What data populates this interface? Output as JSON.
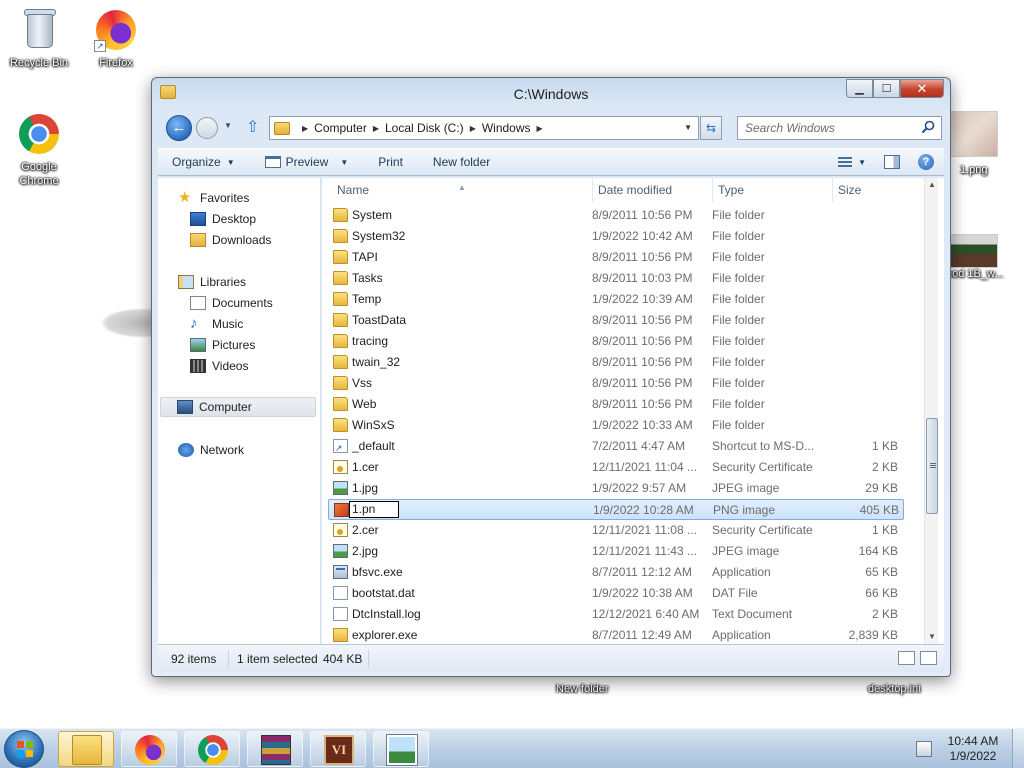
{
  "desktop": {
    "icons": [
      {
        "label": "Recycle Bin",
        "icon": "recycle-bin-icon"
      },
      {
        "label": "Firefox",
        "icon": "firefox-icon"
      },
      {
        "label": "Google Chrome",
        "icon": "chrome-icon"
      }
    ],
    "partial_labels": {
      "right_png": "1.png",
      "right_video": "nod 1B_w...",
      "new_folder": "New folder",
      "desktop_ini": "desktop.ini"
    }
  },
  "window": {
    "title": "C:\\Windows",
    "address": {
      "crumbs": [
        "Computer",
        "Local Disk (C:)",
        "Windows"
      ]
    },
    "search_placeholder": "Search Windows",
    "toolbar": {
      "organize": "Organize",
      "preview": "Preview",
      "print": "Print",
      "new_folder": "New folder"
    },
    "nav_pane": {
      "favorites": "Favorites",
      "desktop": "Desktop",
      "downloads": "Downloads",
      "libraries": "Libraries",
      "documents": "Documents",
      "music": "Music",
      "pictures": "Pictures",
      "videos": "Videos",
      "computer": "Computer",
      "network": "Network"
    },
    "columns": {
      "name": "Name",
      "date": "Date modified",
      "type": "Type",
      "size": "Size"
    },
    "files": [
      {
        "name": "System",
        "date": "8/9/2011 10:56 PM",
        "type": "File folder",
        "size": "",
        "icon": "folder"
      },
      {
        "name": "System32",
        "date": "1/9/2022 10:42 AM",
        "type": "File folder",
        "size": "",
        "icon": "folder"
      },
      {
        "name": "TAPI",
        "date": "8/9/2011 10:56 PM",
        "type": "File folder",
        "size": "",
        "icon": "folder"
      },
      {
        "name": "Tasks",
        "date": "8/9/2011 10:03 PM",
        "type": "File folder",
        "size": "",
        "icon": "folder"
      },
      {
        "name": "Temp",
        "date": "1/9/2022 10:39 AM",
        "type": "File folder",
        "size": "",
        "icon": "folder"
      },
      {
        "name": "ToastData",
        "date": "8/9/2011 10:56 PM",
        "type": "File folder",
        "size": "",
        "icon": "folder"
      },
      {
        "name": "tracing",
        "date": "8/9/2011 10:56 PM",
        "type": "File folder",
        "size": "",
        "icon": "folder"
      },
      {
        "name": "twain_32",
        "date": "8/9/2011 10:56 PM",
        "type": "File folder",
        "size": "",
        "icon": "folder"
      },
      {
        "name": "Vss",
        "date": "8/9/2011 10:56 PM",
        "type": "File folder",
        "size": "",
        "icon": "folder"
      },
      {
        "name": "Web",
        "date": "8/9/2011 10:56 PM",
        "type": "File folder",
        "size": "",
        "icon": "folder"
      },
      {
        "name": "WinSxS",
        "date": "1/9/2022 10:33 AM",
        "type": "File folder",
        "size": "",
        "icon": "folder"
      },
      {
        "name": "_default",
        "date": "7/2/2011 4:47 AM",
        "type": "Shortcut to MS-D...",
        "size": "1 KB",
        "icon": "shortcut"
      },
      {
        "name": "1.cer",
        "date": "12/11/2021 11:04 ...",
        "type": "Security Certificate",
        "size": "2 KB",
        "icon": "cert"
      },
      {
        "name": "1.jpg",
        "date": "1/9/2022 9:57 AM",
        "type": "JPEG image",
        "size": "29 KB",
        "icon": "img"
      },
      {
        "name": "1.pn",
        "date": "1/9/2022 10:28 AM",
        "type": "PNG image",
        "size": "405 KB",
        "icon": "png"
      },
      {
        "name": "2.cer",
        "date": "12/11/2021 11:08 ...",
        "type": "Security Certificate",
        "size": "1 KB",
        "icon": "cert"
      },
      {
        "name": "2.jpg",
        "date": "12/11/2021 11:43 ...",
        "type": "JPEG image",
        "size": "164 KB",
        "icon": "img"
      },
      {
        "name": "bfsvc.exe",
        "date": "8/7/2011 12:12 AM",
        "type": "Application",
        "size": "65 KB",
        "icon": "exe"
      },
      {
        "name": "bootstat.dat",
        "date": "1/9/2022 10:38 AM",
        "type": "DAT File",
        "size": "66 KB",
        "icon": "doc"
      },
      {
        "name": "DtcInstall.log",
        "date": "12/12/2021 6:40 AM",
        "type": "Text Document",
        "size": "2 KB",
        "icon": "doc"
      },
      {
        "name": "explorer.exe",
        "date": "8/7/2011 12:49 AM",
        "type": "Application",
        "size": "2,839 KB",
        "icon": "explorer"
      }
    ],
    "rename_value": "1.pn",
    "selected_row": 14,
    "status": {
      "items": "92 items",
      "selected": "1 item selected",
      "size": "404 KB"
    }
  },
  "taskbar": {
    "apps": [
      "windows-explorer",
      "firefox",
      "chrome",
      "winrar",
      "vi-app",
      "photo-viewer"
    ],
    "time": "10:44 AM",
    "date": "1/9/2022"
  }
}
